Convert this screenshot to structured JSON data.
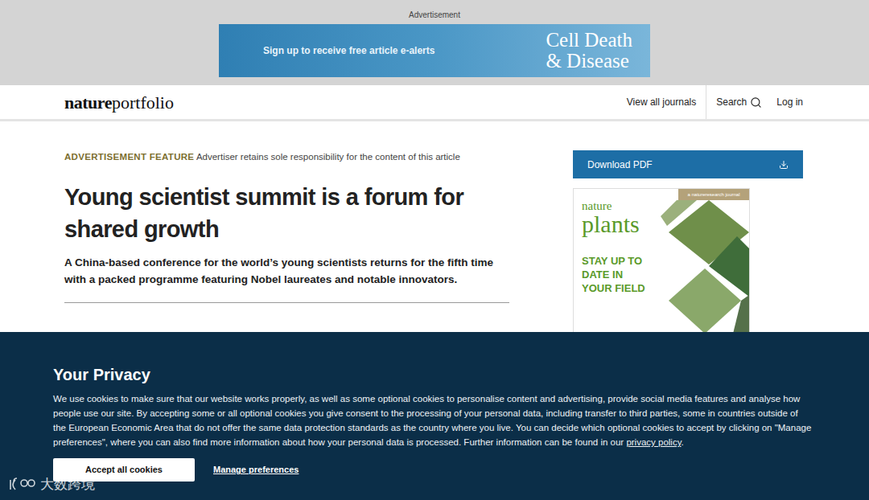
{
  "ad_banner": {
    "label": "Advertisement",
    "cta": "Sign up to receive free article e-alerts",
    "journal": [
      "Cell Death",
      "& Disease"
    ]
  },
  "header": {
    "logo": {
      "bold": "nature",
      "regular": "portfolio"
    },
    "nav": [
      "View all journals",
      "Search",
      "Log in"
    ]
  },
  "article": {
    "tag": "ADVERTISEMENT FEATURE",
    "disclaimer": "Advertiser retains sole responsibility for the content of this article",
    "title": "Young scientist summit is a forum for shared growth",
    "standfirst": "A China-based conference for the world’s young scientists returns for the fifth time with a packed programme featuring Nobel laureates and notable innovators."
  },
  "sidebar": {
    "download": "Download PDF",
    "ad": {
      "badge": "a natureresearch journal",
      "brand": "nature",
      "journal": "plants",
      "cta": [
        "STAY UP TO",
        "DATE IN",
        "YOUR FIELD"
      ]
    }
  },
  "privacy": {
    "title": "Your Privacy",
    "text": "We use cookies to make sure that our website works properly, as well as some optional cookies to personalise content and advertising, provide social media features and analyse how people use our site. By accepting some or all optional cookies you give consent to the processing of your personal data, including transfer to third parties, some in countries outside of the European Economic Area that do not offer the same data protection standards as the country where you live. You can decide which optional cookies to accept by clicking on \"Manage preferences\", where you can also find more information about how your personal data is processed. Further information can be found in our ",
    "link": "privacy policy",
    "end": ".",
    "accept": "Accept all cookies",
    "manage": "Manage preferences"
  },
  "watermark": "大数跨境"
}
